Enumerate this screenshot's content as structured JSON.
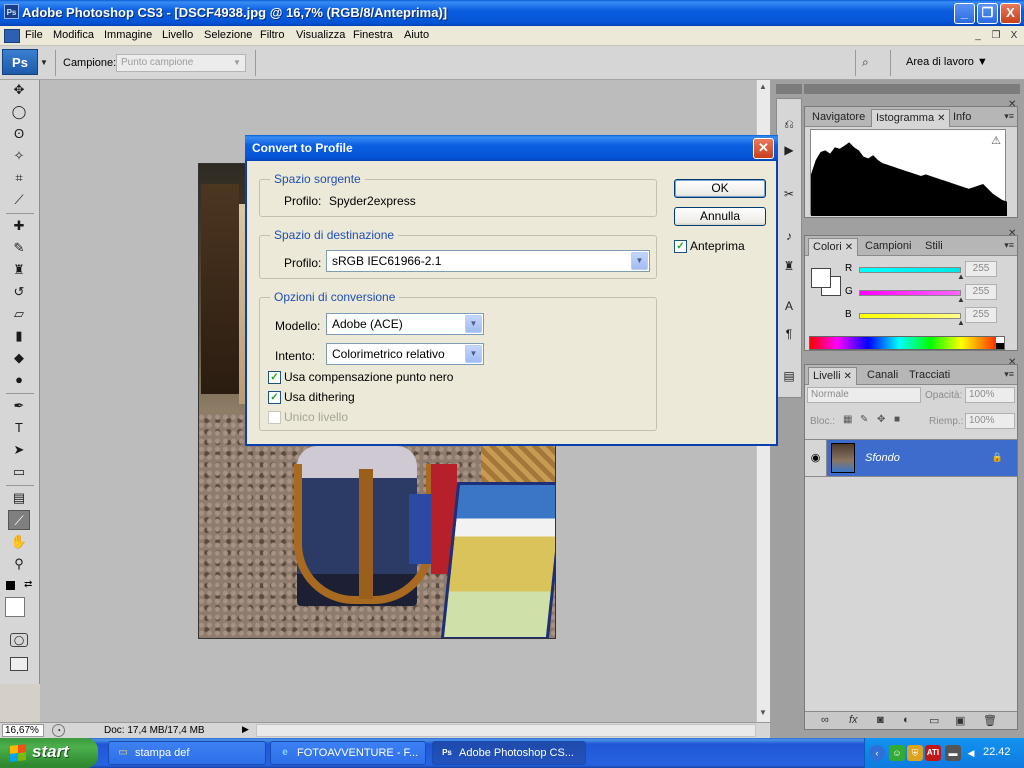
{
  "app": {
    "badge": "Ps",
    "title": "Adobe Photoshop CS3 - [DSCF4938.jpg @ 16,7% (RGB/8/Anteprima)]",
    "window_controls": [
      "_",
      "❐",
      "X"
    ]
  },
  "menubar": {
    "items": [
      "File",
      "Modifica",
      "Immagine",
      "Livello",
      "Selezione",
      "Filtro",
      "Visualizza",
      "Finestra",
      "Aiuto"
    ],
    "doc_controls": [
      "_",
      "❐",
      "X"
    ]
  },
  "options": {
    "logo": "Ps",
    "sample_label": "Campione:",
    "sample_value": "Punto campione",
    "workspace_label": "Area di lavoro ▼"
  },
  "toolbox": {
    "tools": [
      {
        "name": "move",
        "glyph": "✥"
      },
      {
        "name": "marquee",
        "glyph": "◯"
      },
      {
        "name": "lasso",
        "glyph": "ʘ"
      },
      {
        "name": "magic-wand",
        "glyph": "✧"
      },
      {
        "name": "crop",
        "glyph": "⌗"
      },
      {
        "name": "slice",
        "glyph": "⟋"
      },
      {
        "name": "healing",
        "glyph": "✚"
      },
      {
        "name": "brush",
        "glyph": "✎"
      },
      {
        "name": "stamp",
        "glyph": "♜"
      },
      {
        "name": "history-brush",
        "glyph": "↺"
      },
      {
        "name": "eraser",
        "glyph": "▱"
      },
      {
        "name": "gradient",
        "glyph": "▮"
      },
      {
        "name": "blur",
        "glyph": "◆"
      },
      {
        "name": "dodge",
        "glyph": "●"
      },
      {
        "name": "pen",
        "glyph": "✒"
      },
      {
        "name": "type",
        "glyph": "T"
      },
      {
        "name": "path-select",
        "glyph": "➤"
      },
      {
        "name": "shape",
        "glyph": "▭"
      },
      {
        "name": "notes",
        "glyph": "▤"
      },
      {
        "name": "eyedropper",
        "glyph": "⟋"
      },
      {
        "name": "hand",
        "glyph": "✋"
      },
      {
        "name": "zoom",
        "glyph": "⚲"
      }
    ],
    "active_tool": "eyedropper"
  },
  "status": {
    "zoom": "16,67%",
    "doc": "Doc: 17,4 MB/17,4 MB"
  },
  "panels": {
    "nav": {
      "tabs": [
        "Navigatore",
        "Istogramma",
        "Info"
      ],
      "active": 1,
      "warn": "⚠"
    },
    "color": {
      "tabs": [
        "Colori",
        "Campioni",
        "Stili"
      ],
      "active": 0,
      "channels": [
        {
          "label": "R",
          "value": "255",
          "color": "#00e6e6"
        },
        {
          "label": "G",
          "value": "255",
          "color": "#ff00ff"
        },
        {
          "label": "B",
          "value": "255",
          "color": "#ffff00"
        }
      ]
    },
    "layers": {
      "tabs": [
        "Livelli",
        "Canali",
        "Tracciati"
      ],
      "active": 0,
      "blend_mode": "Normale",
      "opacity_label": "Opacità:",
      "opacity": "100%",
      "lock_label": "Bloc.:",
      "fill_label": "Riemp.:",
      "fill": "100%",
      "layer_name": "Sfondo"
    }
  },
  "dialog": {
    "title": "Convert to Profile",
    "close": "✕",
    "source": {
      "heading": "Spazio sorgente",
      "profile_label": "Profilo:",
      "profile_value": "Spyder2express"
    },
    "destination": {
      "heading": "Spazio di destinazione",
      "profile_label": "Profilo:",
      "profile_value": "sRGB IEC61966-2.1"
    },
    "conversion": {
      "heading": "Opzioni di conversione",
      "engine_label": "Modello:",
      "engine_value": "Adobe (ACE)",
      "intent_label": "Intento:",
      "intent_value": "Colorimetrico relativo",
      "bpc_label": "Usa compensazione punto nero",
      "bpc_checked": true,
      "dither_label": "Usa dithering",
      "dither_checked": true,
      "flatten_label": "Unico livello",
      "flatten_checked": false
    },
    "ok": "OK",
    "cancel": "Annulla",
    "preview_label": "Anteprima",
    "preview_checked": true
  },
  "taskbar": {
    "start": "start",
    "tasks": [
      {
        "label": "stampa def",
        "icon": "folder-icon",
        "glyph": "▭"
      },
      {
        "label": "FOTOAVVENTURE - F...",
        "icon": "ie-icon",
        "glyph": "e"
      },
      {
        "label": "Adobe Photoshop CS...",
        "icon": "photoshop-icon",
        "glyph": "Ps"
      }
    ],
    "clock": "22.42"
  },
  "histogram": {
    "heights": [
      0.52,
      0.7,
      0.8,
      0.82,
      0.78,
      0.86,
      0.84,
      0.88,
      0.92,
      0.86,
      0.82,
      0.74,
      0.72,
      0.76,
      0.7,
      0.66,
      0.64,
      0.62,
      0.6,
      0.58,
      0.56,
      0.54,
      0.52,
      0.5,
      0.52,
      0.5,
      0.48,
      0.46,
      0.44,
      0.42,
      0.4,
      0.38,
      0.36,
      0.34,
      0.36,
      0.38,
      0.4,
      0.34,
      0.28,
      0.24,
      0.2,
      0.18
    ]
  }
}
